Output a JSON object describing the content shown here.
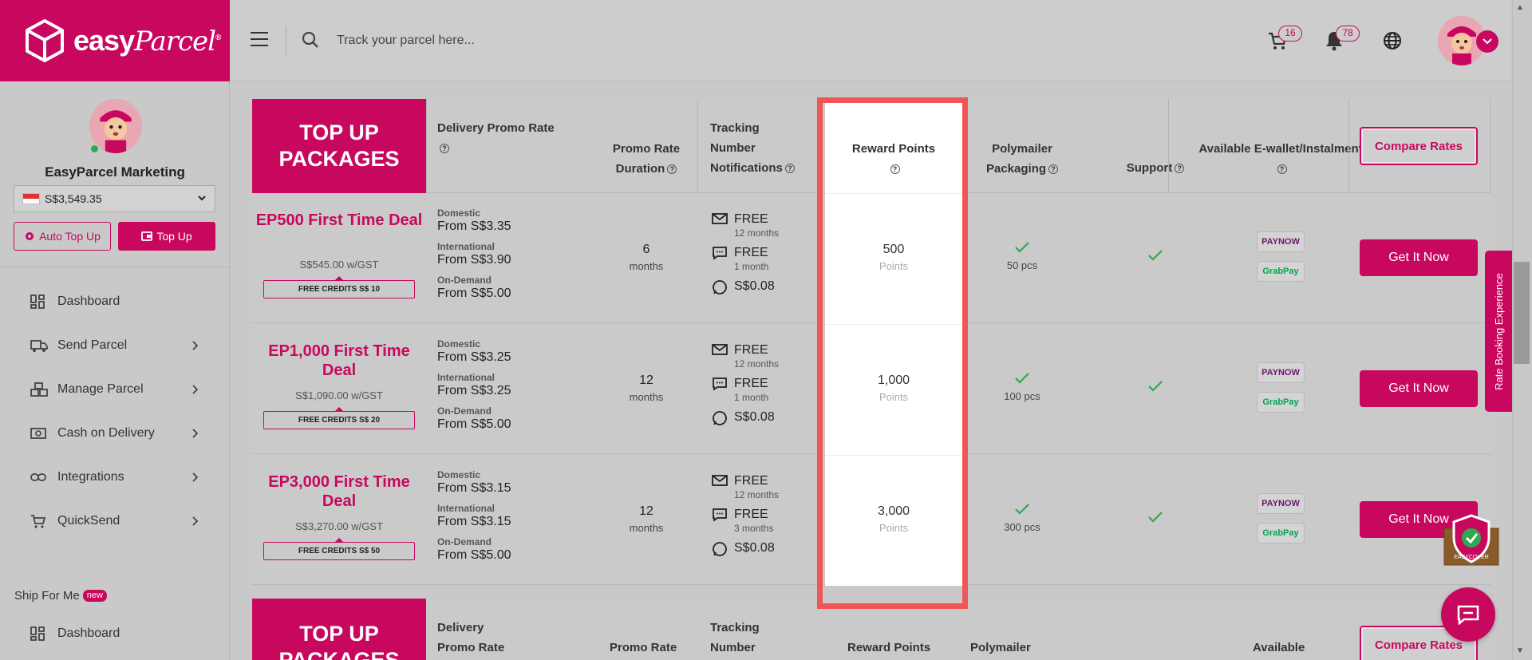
{
  "brand": {
    "name": "easy",
    "name_script": "Parcel",
    "reg": "®",
    "color": "#c8085f"
  },
  "header": {
    "search_placeholder": "Track your parcel here...",
    "cart_count": "16",
    "notif_count": "78",
    "icons": [
      "menu-icon",
      "search-icon",
      "cart-icon",
      "bell-icon",
      "globe-icon",
      "chevron-down-icon"
    ]
  },
  "sidebar": {
    "account_name": "EasyParcel Marketing",
    "balance": "S$3,549.35",
    "auto_topup_label": "Auto Top Up",
    "topup_label": "Top Up",
    "items": [
      {
        "label": "Dashboard",
        "icon": "dashboard-icon"
      },
      {
        "label": "Send Parcel",
        "icon": "truck-icon"
      },
      {
        "label": "Manage Parcel",
        "icon": "boxes-icon"
      },
      {
        "label": "Cash on Delivery",
        "icon": "cash-icon"
      },
      {
        "label": "Integrations",
        "icon": "link-icon"
      },
      {
        "label": "QuickSend",
        "icon": "cart-plus-icon"
      }
    ],
    "ship_for_me": {
      "label": "Ship For Me",
      "badge": "new",
      "item": "Dashboard"
    }
  },
  "table": {
    "package_header": "TOP UP PACKAGES",
    "columns": {
      "delivery_rate": "Delivery Promo Rate",
      "duration": "Promo Rate Duration",
      "tracking": "Tracking Number Notifications",
      "reward": "Reward Points",
      "poly": "Polymailer Packaging",
      "support": "Support",
      "wallet": "Available E-wallet/Instalment"
    },
    "compare_label": "Compare Rates",
    "get_label": "Get It Now",
    "rate_labels": {
      "domestic": "Domestic",
      "international": "International",
      "ondemand": "On-Demand"
    },
    "notif_labels": {
      "free": "FREE"
    },
    "wallets": {
      "paynow": "PAYNOW",
      "grabpay": "GrabPay"
    },
    "rows": [
      {
        "title": "EP500 First Time Deal",
        "price": "S$545.00 w/GST",
        "credits": "FREE CREDITS S$ 10",
        "domestic": "From S$3.35",
        "international": "From S$3.90",
        "ondemand": "From S$5.00",
        "duration": "6",
        "duration_unit": "months",
        "email": "12 months",
        "sms": "1 month",
        "whatsapp": "S$0.08",
        "points": "500",
        "points_unit": "Points",
        "poly": "50 pcs"
      },
      {
        "title": "EP1,000 First Time Deal",
        "price": "S$1,090.00 w/GST",
        "credits": "FREE CREDITS S$ 20",
        "domestic": "From S$3.25",
        "international": "From S$3.25",
        "ondemand": "From S$5.00",
        "duration": "12",
        "duration_unit": "months",
        "email": "12 months",
        "sms": "1 month",
        "whatsapp": "S$0.08",
        "points": "1,000",
        "points_unit": "Points",
        "poly": "100 pcs"
      },
      {
        "title": "EP3,000 First Time Deal",
        "price": "S$3,270.00 w/GST",
        "credits": "FREE CREDITS S$ 50",
        "domestic": "From S$3.15",
        "international": "From S$3.15",
        "ondemand": "From S$5.00",
        "duration": "12",
        "duration_unit": "months",
        "email": "12 months",
        "sms": "3 months",
        "whatsapp": "S$0.08",
        "points": "3,000",
        "points_unit": "Points",
        "poly": "300 pcs"
      }
    ],
    "second_header": {
      "package_header": "TOP UP PACKAGES",
      "delivery": "Delivery",
      "promo_rate": "Promo Rate",
      "promo_rate_2": "Promo Rate",
      "tracking": "Tracking",
      "number": "Number",
      "reward": "Reward Points",
      "poly": "Polymailer",
      "wallet": "Available"
    }
  },
  "widgets": {
    "rate_exp_label": "Rate Booking Experience",
    "easycover_label": "EASYCOVER"
  }
}
